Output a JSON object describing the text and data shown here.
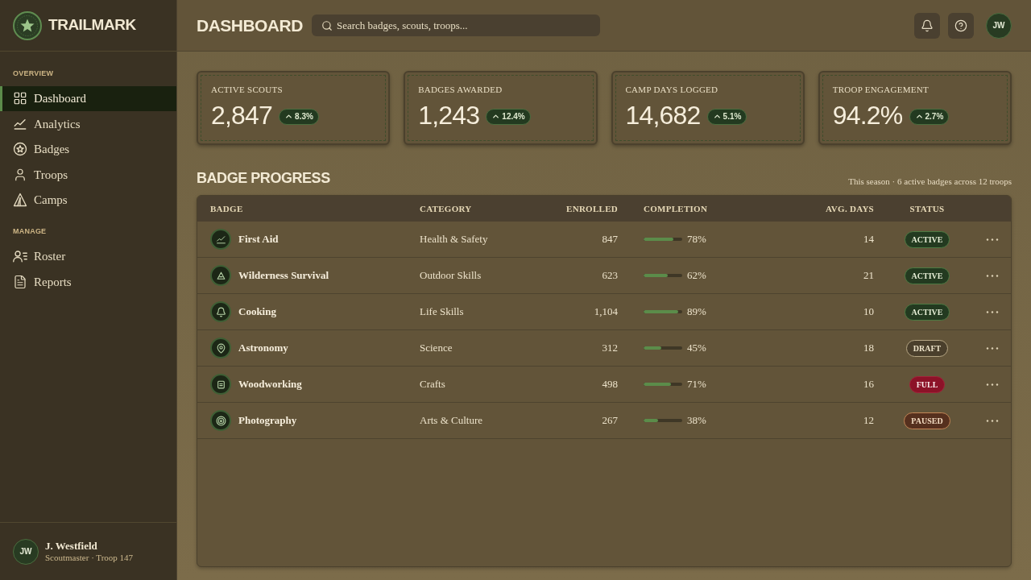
{
  "sidebar": {
    "brand": "TRAILMARK",
    "sections": [
      {
        "title": "OVERVIEW",
        "items": [
          {
            "label": "Dashboard",
            "selected": true
          },
          {
            "label": "Analytics",
            "selected": false
          },
          {
            "label": "Badges",
            "selected": false
          },
          {
            "label": "Troops",
            "selected": false
          },
          {
            "label": "Camps",
            "selected": false
          }
        ]
      },
      {
        "title": "MANAGE",
        "items": [
          {
            "label": "Roster",
            "selected": false
          },
          {
            "label": "Reports",
            "selected": false
          }
        ]
      }
    ],
    "user": {
      "initials": "JW",
      "name": "J. Westfield",
      "role": "Scoutmaster · Troop 147"
    }
  },
  "header": {
    "title": "DASHBOARD",
    "search": {
      "placeholder": "Search badges, scouts, troops..."
    },
    "user_initials": "JW"
  },
  "stats": [
    {
      "label": "ACTIVE SCOUTS",
      "value": "2,847",
      "change": "8.3%"
    },
    {
      "label": "BADGES AWARDED",
      "value": "1,243",
      "change": "12.4%"
    },
    {
      "label": "CAMP DAYS LOGGED",
      "value": "14,682",
      "change": "5.1%"
    },
    {
      "label": "TROOP ENGAGEMENT",
      "value": "94.2%",
      "change": "2.7%"
    }
  ],
  "badge_progress": {
    "title": "BADGE PROGRESS",
    "summary": "This season · 6 active badges across 12 troops",
    "columns": [
      "BADGE",
      "CATEGORY",
      "ENROLLED",
      "COMPLETION",
      "AVG. DAYS",
      "STATUS"
    ],
    "rows": [
      {
        "name": "First Aid",
        "category": "Health & Safety",
        "enrolled": "847",
        "completion": "78%",
        "level": 0.78,
        "avg_days": "14",
        "status": {
          "label": "ACTIVE",
          "kind": "active"
        }
      },
      {
        "name": "Wilderness Survival",
        "category": "Outdoor Skills",
        "enrolled": "623",
        "completion": "62%",
        "level": 0.62,
        "avg_days": "21",
        "status": {
          "label": "ACTIVE",
          "kind": "active"
        }
      },
      {
        "name": "Cooking",
        "category": "Life Skills",
        "enrolled": "1,104",
        "completion": "89%",
        "level": 0.89,
        "avg_days": "10",
        "status": {
          "label": "ACTIVE",
          "kind": "active"
        }
      },
      {
        "name": "Astronomy",
        "category": "Science",
        "enrolled": "312",
        "completion": "45%",
        "level": 0.45,
        "avg_days": "18",
        "status": {
          "label": "DRAFT",
          "kind": "draft"
        }
      },
      {
        "name": "Woodworking",
        "category": "Crafts",
        "enrolled": "498",
        "completion": "71%",
        "level": 0.71,
        "avg_days": "16",
        "status": {
          "label": "FULL",
          "kind": "full"
        }
      },
      {
        "name": "Photography",
        "category": "Arts & Culture",
        "enrolled": "267",
        "completion": "38%",
        "level": 0.38,
        "avg_days": "12",
        "status": {
          "label": "PAUSED",
          "kind": "paused"
        }
      }
    ]
  }
}
